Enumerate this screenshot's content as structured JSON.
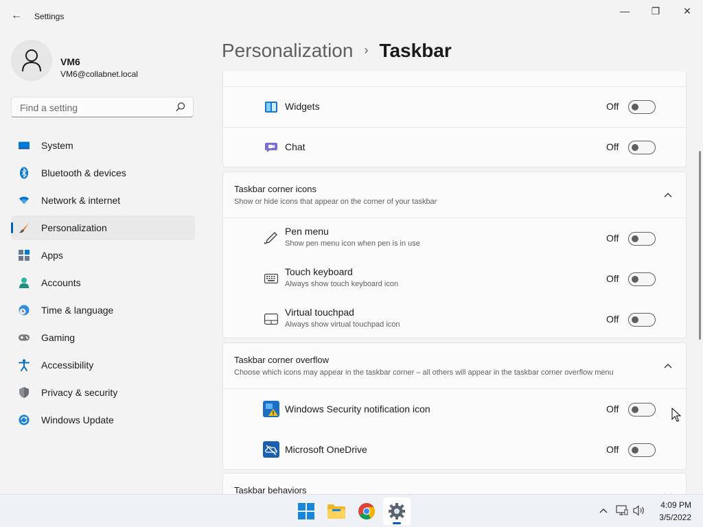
{
  "app": {
    "title": "Settings",
    "back_glyph": "←",
    "window_controls": {
      "minimize": "—",
      "maximize": "❐",
      "close": "✕"
    }
  },
  "user": {
    "name": "VM6",
    "email": "VM6@collabnet.local"
  },
  "search": {
    "placeholder": "Find a setting",
    "value": ""
  },
  "sidebar": {
    "items": [
      {
        "label": "System",
        "icon": "system-icon",
        "active": false
      },
      {
        "label": "Bluetooth & devices",
        "icon": "bluetooth-icon",
        "active": false
      },
      {
        "label": "Network & internet",
        "icon": "wifi-icon",
        "active": false
      },
      {
        "label": "Personalization",
        "icon": "brush-icon",
        "active": true
      },
      {
        "label": "Apps",
        "icon": "apps-icon",
        "active": false
      },
      {
        "label": "Accounts",
        "icon": "accounts-icon",
        "active": false
      },
      {
        "label": "Time & language",
        "icon": "clock-globe-icon",
        "active": false
      },
      {
        "label": "Gaming",
        "icon": "gamepad-icon",
        "active": false
      },
      {
        "label": "Accessibility",
        "icon": "accessibility-icon",
        "active": false
      },
      {
        "label": "Privacy & security",
        "icon": "shield-icon",
        "active": false
      },
      {
        "label": "Windows Update",
        "icon": "update-icon",
        "active": false
      }
    ]
  },
  "breadcrumb": {
    "parent": "Personalization",
    "separator": "›",
    "current": "Taskbar"
  },
  "taskbar_items": [
    {
      "label": "Widgets",
      "state": "Off",
      "on": false,
      "icon": "widgets-icon"
    },
    {
      "label": "Chat",
      "state": "Off",
      "on": false,
      "icon": "chat-icon"
    }
  ],
  "corner_icons": {
    "title": "Taskbar corner icons",
    "description": "Show or hide icons that appear on the corner of your taskbar",
    "items": [
      {
        "label": "Pen menu",
        "description": "Show pen menu icon when pen is in use",
        "state": "Off",
        "on": false,
        "icon": "pen-icon"
      },
      {
        "label": "Touch keyboard",
        "description": "Always show touch keyboard icon",
        "state": "Off",
        "on": false,
        "icon": "keyboard-icon"
      },
      {
        "label": "Virtual touchpad",
        "description": "Always show virtual touchpad icon",
        "state": "Off",
        "on": false,
        "icon": "touchpad-icon"
      }
    ]
  },
  "corner_overflow": {
    "title": "Taskbar corner overflow",
    "description": "Choose which icons may appear in the taskbar corner – all others will appear in the taskbar corner overflow menu",
    "items": [
      {
        "label": "Windows Security notification icon",
        "state": "Off",
        "on": false,
        "icon": "windows-security-icon"
      },
      {
        "label": "Microsoft OneDrive",
        "state": "Off",
        "on": false,
        "icon": "onedrive-icon"
      }
    ]
  },
  "behaviors": {
    "title": "Taskbar behaviors"
  },
  "os_taskbar": {
    "apps": [
      {
        "name": "start",
        "icon": "windows-start-icon",
        "active": false
      },
      {
        "name": "file-explorer",
        "icon": "folder-icon",
        "active": false
      },
      {
        "name": "chrome",
        "icon": "chrome-icon",
        "active": false
      },
      {
        "name": "settings",
        "icon": "gear-icon",
        "active": true
      }
    ],
    "time": "4:09 PM",
    "date": "3/5/2022"
  },
  "colors": {
    "accent": "#005fb8",
    "window_bg": "#f3f3f3",
    "card_bg": "#fbfbfb",
    "text_secondary": "#5f5f5f"
  }
}
